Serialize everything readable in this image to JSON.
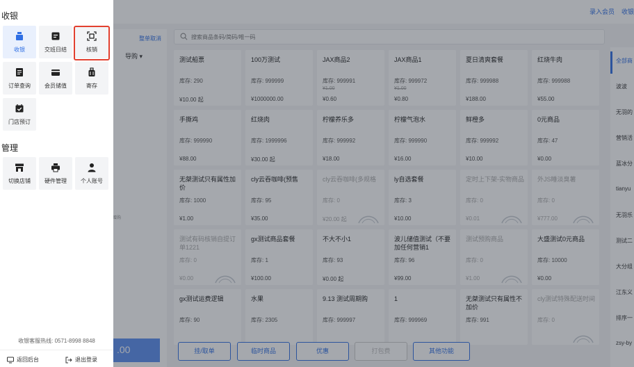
{
  "top_links": [
    "录入会员",
    "收银"
  ],
  "cart": {
    "clear_label": "整单取消",
    "guide_label": "导购 ▾",
    "hint": "赠购",
    "pay_amount": ".00"
  },
  "search": {
    "placeholder": "搜索商品条码/简码/唯一码"
  },
  "products": [
    {
      "name": "测试船票",
      "stock": "库存: 290",
      "orig": "",
      "price": "¥10.00 起",
      "gray": false,
      "sold_out": false
    },
    {
      "name": "100万测试",
      "stock": "库存: 999999",
      "orig": "",
      "price": "¥1000000.00",
      "gray": false,
      "sold_out": false
    },
    {
      "name": "JAX商品2",
      "stock": "库存: 999991",
      "orig": "¥1.00",
      "price": "¥0.60",
      "gray": false,
      "sold_out": false
    },
    {
      "name": "JAX商品1",
      "stock": "库存: 999972",
      "orig": "¥1.00",
      "price": "¥0.80",
      "gray": false,
      "sold_out": false
    },
    {
      "name": "夏日清爽套餐",
      "stock": "库存: 999988",
      "orig": "",
      "price": "¥188.00",
      "gray": false,
      "sold_out": false
    },
    {
      "name": "红烧牛肉",
      "stock": "库存: 999988",
      "orig": "",
      "price": "¥55.00",
      "gray": false,
      "sold_out": false
    },
    {
      "name": "手撕鸡",
      "stock": "库存: 999990",
      "orig": "",
      "price": "¥88.00",
      "gray": false,
      "sold_out": false
    },
    {
      "name": "红烧肉",
      "stock": "库存: 1999996",
      "orig": "",
      "price": "¥30.00 起",
      "gray": false,
      "sold_out": false
    },
    {
      "name": "柠檬养乐多",
      "stock": "库存: 999992",
      "orig": "",
      "price": "¥18.00",
      "gray": false,
      "sold_out": false
    },
    {
      "name": "柠檬气泡水",
      "stock": "库存: 999990",
      "orig": "",
      "price": "¥16.00",
      "gray": false,
      "sold_out": false
    },
    {
      "name": "鲜橙多",
      "stock": "库存: 999992",
      "orig": "",
      "price": "¥10.00",
      "gray": false,
      "sold_out": false
    },
    {
      "name": "0元商品",
      "stock": "库存: 47",
      "orig": "",
      "price": "¥0.00",
      "gray": false,
      "sold_out": false
    },
    {
      "name": "无桀测试只有属性加价",
      "stock": "库存: 1000",
      "orig": "",
      "price": "¥1.00",
      "gray": false,
      "sold_out": false
    },
    {
      "name": "cly云吞咖啡(预售",
      "stock": "库存: 95",
      "orig": "",
      "price": "¥35.00",
      "gray": false,
      "sold_out": false
    },
    {
      "name": "cly云吞咖啡(多规格",
      "stock": "库存: 0",
      "orig": "",
      "price": "¥20.00 起",
      "gray": true,
      "sold_out": true
    },
    {
      "name": "ly自选套餐",
      "stock": "库存: 3",
      "orig": "",
      "price": "¥10.00",
      "gray": false,
      "sold_out": false
    },
    {
      "name": "定时上下架-实物商品",
      "stock": "库存: 0",
      "orig": "",
      "price": "¥0.01",
      "gray": true,
      "sold_out": true
    },
    {
      "name": "外JS睡淡臭薯",
      "stock": "库存: 0",
      "orig": "",
      "price": "¥777.00",
      "gray": true,
      "sold_out": true
    },
    {
      "name": "测试有码核销自提订单1221",
      "stock": "库存: 0",
      "orig": "",
      "price": "¥0.00",
      "gray": true,
      "sold_out": true
    },
    {
      "name": "gx测试商品套餐",
      "stock": "库存: 1",
      "orig": "",
      "price": "¥100.00",
      "gray": false,
      "sold_out": false
    },
    {
      "name": "不大不小1",
      "stock": "库存: 93",
      "orig": "",
      "price": "¥0.00 起",
      "gray": false,
      "sold_out": false
    },
    {
      "name": "波儿储值测试（不要加任何营销1",
      "stock": "库存: 96",
      "orig": "",
      "price": "¥99.00",
      "gray": false,
      "sold_out": false
    },
    {
      "name": "测试预购商品",
      "stock": "库存: 0",
      "orig": "",
      "price": "¥1.00",
      "gray": true,
      "sold_out": true
    },
    {
      "name": "大盛测试0元商品",
      "stock": "库存: 10000",
      "orig": "",
      "price": "¥0.00",
      "gray": false,
      "sold_out": false
    },
    {
      "name": "gx测试运费逻辑",
      "stock": "库存: 90",
      "orig": "",
      "price": "",
      "gray": false,
      "sold_out": false
    },
    {
      "name": "水果",
      "stock": "库存: 2305",
      "orig": "",
      "price": "",
      "gray": false,
      "sold_out": false
    },
    {
      "name": "9.13 测试周期购",
      "stock": "库存: 999997",
      "orig": "",
      "price": "",
      "gray": false,
      "sold_out": false
    },
    {
      "name": "1",
      "stock": "库存: 999969",
      "orig": "",
      "price": "",
      "gray": false,
      "sold_out": false
    },
    {
      "name": "无桀测试只有属性不加价",
      "stock": "库存: 991",
      "orig": "",
      "price": "",
      "gray": false,
      "sold_out": false
    },
    {
      "name": "cly测试特殊配送时间",
      "stock": "库存: 0",
      "orig": "",
      "price": "",
      "gray": true,
      "sold_out": true
    }
  ],
  "actions": [
    {
      "label": "挂/取单",
      "disabled": false
    },
    {
      "label": "临时商品",
      "disabled": false
    },
    {
      "label": "优惠",
      "disabled": false
    },
    {
      "label": "打包费",
      "disabled": true
    },
    {
      "label": "其他功能",
      "disabled": false
    }
  ],
  "categories": [
    "全部商",
    "波波",
    "无羽的",
    "营销活",
    "蓝冰分",
    "tianyu",
    "无羽乐",
    "测试二",
    "大分组",
    "江东义",
    "排序一",
    "zsy-by"
  ],
  "drawer": {
    "section_cashier": "收银",
    "section_manage": "管理",
    "cashier_items": [
      {
        "label": "收银",
        "icon": "cashier-icon",
        "active": true
      },
      {
        "label": "交班日结",
        "icon": "shift-report-icon",
        "active": false
      },
      {
        "label": "核销",
        "icon": "scan-verify-icon",
        "active": false
      },
      {
        "label": "订单查询",
        "icon": "order-list-icon",
        "active": false
      },
      {
        "label": "会员储值",
        "icon": "member-card-icon",
        "active": false
      },
      {
        "label": "寄存",
        "icon": "luggage-icon",
        "active": false
      },
      {
        "label": "门店预订",
        "icon": "calendar-check-icon",
        "active": false
      }
    ],
    "manage_items": [
      {
        "label": "切换店铺",
        "icon": "store-icon",
        "active": false
      },
      {
        "label": "硬件管理",
        "icon": "printer-icon",
        "active": false
      },
      {
        "label": "个人账号",
        "icon": "user-icon",
        "active": false
      }
    ],
    "hotline": "收银客服热线: 0571-8998 8848",
    "back_label": "返回后台",
    "logout_label": "退出登录"
  },
  "colors": {
    "accent": "#2f6fe4",
    "highlight": "#e2402f",
    "tile_bg": "#f3f4f6",
    "tile_active_bg": "#e9f0fd"
  }
}
